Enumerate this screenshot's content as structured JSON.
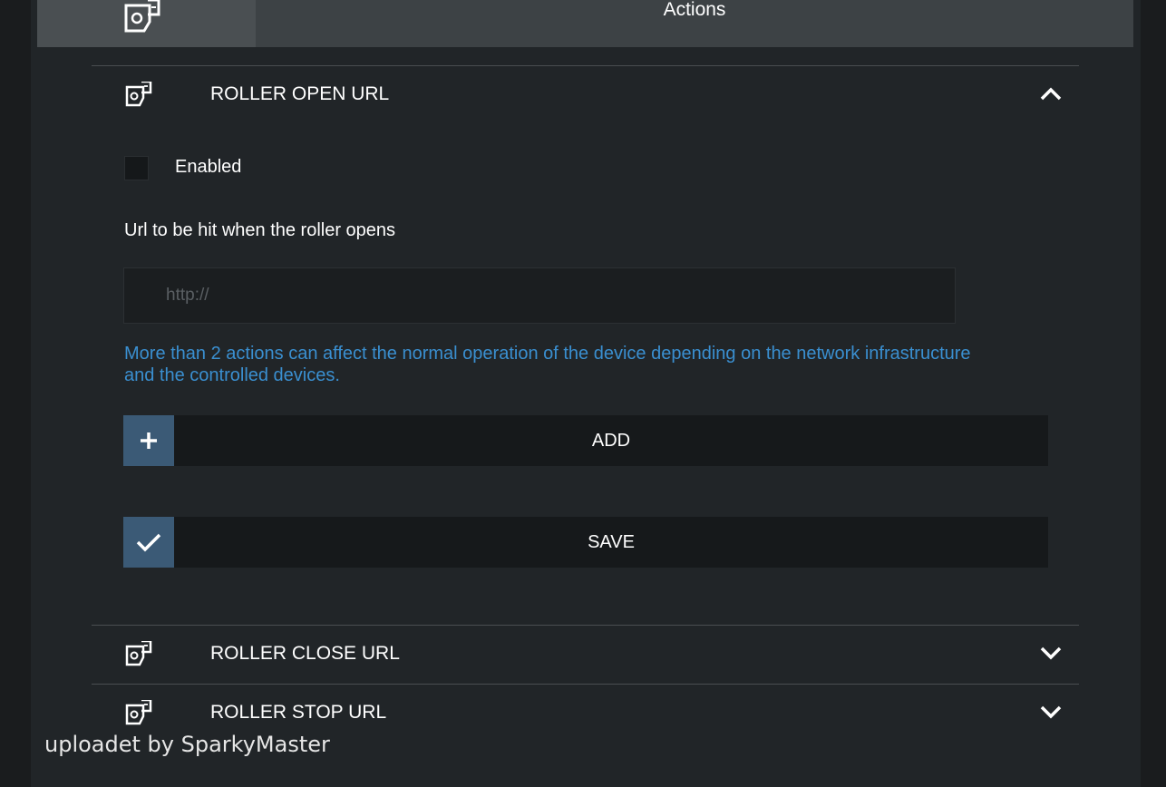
{
  "header": {
    "title": "Actions",
    "icon": "plug-timer-icon"
  },
  "sections": [
    {
      "label": "ROLLER OPEN URL",
      "icon": "plug-timer-icon",
      "expanded": true
    },
    {
      "label": "ROLLER CLOSE URL",
      "icon": "plug-timer-icon",
      "expanded": false
    },
    {
      "label": "ROLLER STOP URL",
      "icon": "plug-timer-icon",
      "expanded": false
    }
  ],
  "open_section": {
    "enabled_label": "Enabled",
    "enabled_checked": false,
    "url_label": "Url to be hit when the roller opens",
    "url_value": "",
    "url_placeholder": "http://",
    "warning": "More than 2 actions can affect the normal operation of the device depending on the network infrastructure and the controlled devices.",
    "add_label": "ADD",
    "save_label": "SAVE"
  },
  "watermark": "uploadet by SparkyMaster",
  "colors": {
    "accent_blue": "#3a8fd0",
    "button_icon_bg": "#3b5a76",
    "header_bg": "#3d4245"
  }
}
